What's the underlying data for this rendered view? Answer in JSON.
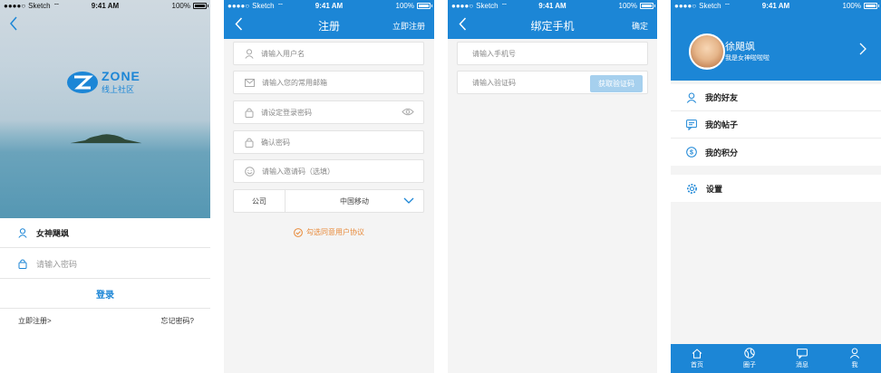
{
  "status_bar": {
    "carrier": "Sketch",
    "time": "9:41 AM",
    "battery": "100%"
  },
  "login": {
    "logo_brand": "ZONE",
    "logo_sub": "线上社区",
    "username_value": "女神飓飒",
    "password_placeholder": "请输入密码",
    "login_button": "登录",
    "register_link": "立即注册>",
    "forgot_link": "忘记密码?"
  },
  "register": {
    "title": "注册",
    "right_action": "立即注册",
    "username_placeholder": "请输入用户名",
    "email_placeholder": "请输入您的常用邮箱",
    "password_placeholder": "请设定登录密码",
    "confirm_placeholder": "确认密码",
    "invite_placeholder": "请输入邀请码（选填）",
    "company_label": "公司",
    "company_value": "中国移动",
    "agree_text": "勾选同意用户协议"
  },
  "bind_phone": {
    "title": "绑定手机",
    "right_action": "确定",
    "phone_placeholder": "请输入手机号",
    "code_placeholder": "请输入验证码",
    "get_code_button": "获取验证码"
  },
  "profile": {
    "name": "徐飓飒",
    "signature": "我是女神啦啦啦",
    "menu": [
      {
        "label": "我的好友",
        "icon": "user-icon"
      },
      {
        "label": "我的帖子",
        "icon": "chat-icon"
      },
      {
        "label": "我的积分",
        "icon": "coin-icon"
      }
    ],
    "settings": {
      "label": "设置",
      "icon": "gear-icon"
    },
    "tabs": [
      {
        "label": "首页",
        "icon": "home-icon"
      },
      {
        "label": "圈子",
        "icon": "circle-icon"
      },
      {
        "label": "消息",
        "icon": "message-icon"
      },
      {
        "label": "我",
        "icon": "person-icon"
      }
    ]
  },
  "colors": {
    "accent": "#1c86d6",
    "warning": "#e88a3a",
    "disabled_button": "#a6d0ee"
  }
}
